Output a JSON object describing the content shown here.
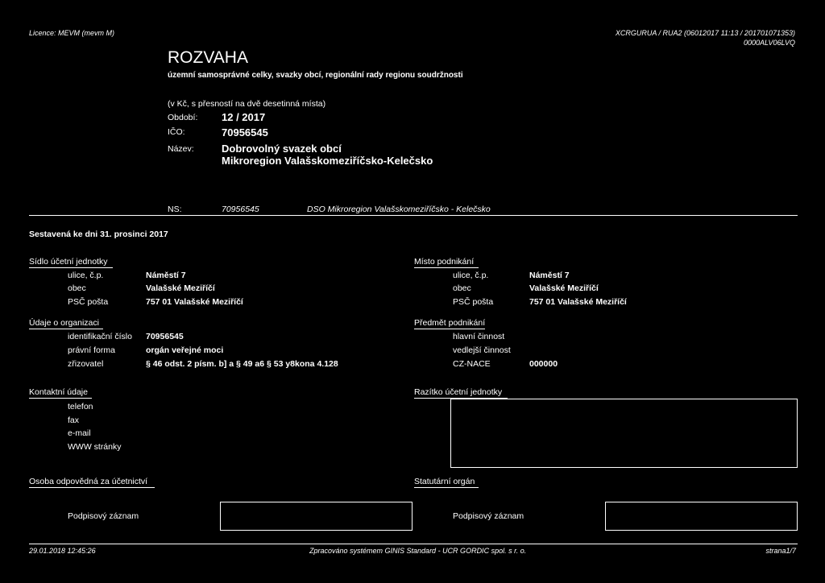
{
  "header": {
    "licence": "Licence: MEVM (mevm M)",
    "report_code": "XCRGURUA / RUA2  (06012017 11:13 / 201701071353)",
    "report_id": "0000ALV06LVQ"
  },
  "title": {
    "main": "ROZVAHA",
    "subtitle": "územní samosprávné celky, svazky obcí, regionální rady regionu soudržnosti",
    "unit_note": "(v Kč, s přesností na dvě desetinná místa)"
  },
  "info": {
    "period_label": "Období:",
    "period_value": "12 / 2017",
    "ico_label": "IČO:",
    "ico_value": "70956545",
    "name_label": "Název:",
    "name_line1": "Dobrovolný svazek obcí",
    "name_line2": "Mikroregion Valašskomeziříčsko-Kelečsko"
  },
  "ns": {
    "label": "NS:",
    "number": "70956545",
    "name": "DSO Mikroregion Valašskomeziříčsko - Kelečsko"
  },
  "compiled": "Sestavená ke dni 31. prosinci 2017",
  "seat": {
    "heading": "Sídlo účetní jednotky",
    "street_label": "ulice, č.p.",
    "street_value": "Náměstí 7",
    "city_label": "obec",
    "city_value": "Valašské Meziříčí",
    "zip_label": "PSČ  pošta",
    "zip_value": "757 01   Valašské Meziříčí"
  },
  "business_place": {
    "heading": "Místo podnikání",
    "street_label": "ulice, č.p.",
    "street_value": "Náměstí 7",
    "city_label": "obec",
    "city_value": "Valašské Meziříčí",
    "zip_label": "PSČ  pošta",
    "zip_value": "757 01   Valašské Meziříčí"
  },
  "org": {
    "heading": "Údaje o organizaci",
    "id_label": "identifikační číslo",
    "id_value": "70956545",
    "form_label": "právní forma",
    "form_value": "orgán veřejné moci",
    "founder_label": "zřizovatel",
    "founder_value": "§ 46 odst. 2 písm. b] a § 49 a6  § 53 y8kona 4.128"
  },
  "subject": {
    "heading": "Předmět podnikání",
    "main_label": "hlavní činnost",
    "side_label": "vedlejší činnost",
    "nace_label": "CZ-NACE",
    "nace_value": "000000"
  },
  "contacts": {
    "heading": "Kontaktní údaje",
    "phone": "telefon",
    "fax": "fax",
    "email": "e-mail",
    "web": "WWW stránky"
  },
  "stamp": {
    "heading": "Razítko účetní jednotky"
  },
  "responsible": {
    "heading": "Osoba odpovědná za účetnictví",
    "signature": "Podpisový záznam"
  },
  "statutory": {
    "heading": "Statutární orgán",
    "signature": "Podpisový záznam"
  },
  "footer": {
    "datetime": "29.01.2018 12:45:26",
    "system": "Zpracováno systémem GINIS Standard - UCR GORDIC spol. s  r. o.",
    "page": "strana1/7"
  }
}
